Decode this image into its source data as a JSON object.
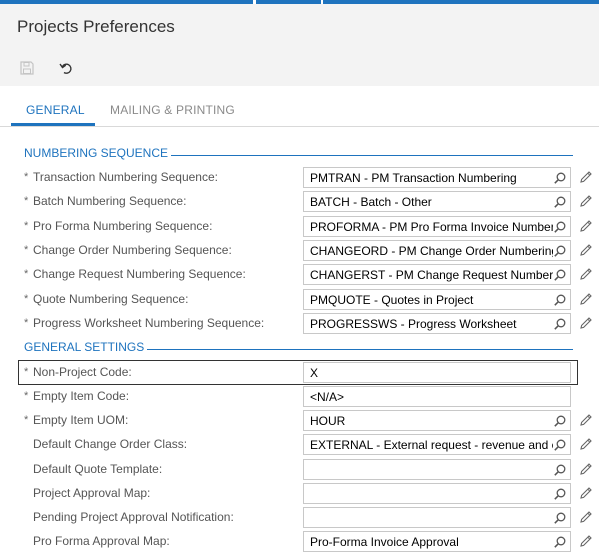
{
  "page": {
    "title": "Projects Preferences"
  },
  "toolbar": {
    "save_icon": "save-icon",
    "undo_icon": "undo-icon"
  },
  "tabs": [
    {
      "label": "GENERAL",
      "active": true
    },
    {
      "label": "MAILING & PRINTING",
      "active": false
    }
  ],
  "sections": {
    "numbering": "NUMBERING SEQUENCE",
    "general": "GENERAL SETTINGS"
  },
  "numbering_rows": [
    {
      "required": "*",
      "label": "Transaction Numbering Sequence:",
      "value": "PMTRAN - PM Transaction Numbering"
    },
    {
      "required": "*",
      "label": "Batch Numbering Sequence:",
      "value": "BATCH - Batch - Other"
    },
    {
      "required": "*",
      "label": "Pro Forma Numbering Sequence:",
      "value": "PROFORMA - PM Pro Forma Invoice Numbering"
    },
    {
      "required": "*",
      "label": "Change Order Numbering Sequence:",
      "value": "CHANGEORD - PM Change Order Numbering"
    },
    {
      "required": "*",
      "label": "Change Request Numbering Sequence:",
      "value": "CHANGERST - PM Change Request Numbering"
    },
    {
      "required": "*",
      "label": "Quote Numbering Sequence:",
      "value": "PMQUOTE - Quotes in Project"
    },
    {
      "required": "*",
      "label": "Progress Worksheet Numbering Sequence:",
      "value": "PROGRESSWS - Progress Worksheet"
    }
  ],
  "general_rows": [
    {
      "required": "*",
      "label": "Non-Project Code:",
      "value": "X"
    },
    {
      "required": "*",
      "label": "Empty Item Code:",
      "value": "<N/A>"
    },
    {
      "required": "*",
      "label": "Empty Item UOM:",
      "value": "HOUR"
    },
    {
      "required": "",
      "label": "Default Change Order Class:",
      "value": "EXTERNAL - External request - revenue and cost"
    },
    {
      "required": "",
      "label": "Default Quote Template:",
      "value": ""
    },
    {
      "required": "",
      "label": "Project Approval Map:",
      "value": ""
    },
    {
      "required": "",
      "label": "Pending Project Approval Notification:",
      "value": ""
    },
    {
      "required": "",
      "label": "Pro Forma Approval Map:",
      "value": "Pro-Forma Invoice Approval"
    }
  ],
  "colors": {
    "accent": "#1e73be",
    "header_bg": "#f3f3f3"
  }
}
